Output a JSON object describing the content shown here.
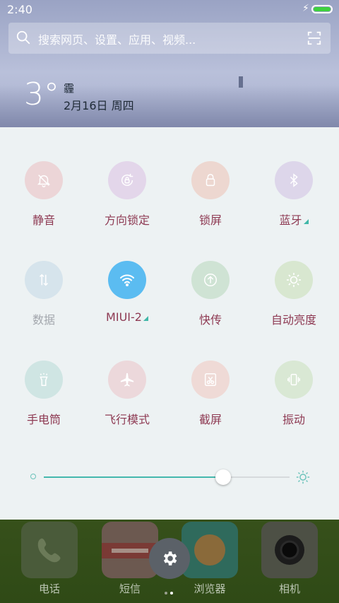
{
  "status": {
    "time": "2:40"
  },
  "search": {
    "placeholder": "搜索网页、设置、应用、视频..."
  },
  "weather": {
    "temperature": "3°",
    "condition": "霾",
    "date": "2月16日 周四"
  },
  "tiles": [
    {
      "label": "静音",
      "icon": "silent-bell-icon"
    },
    {
      "label": "方向锁定",
      "icon": "rotation-lock-icon"
    },
    {
      "label": "锁屏",
      "icon": "lock-icon"
    },
    {
      "label": "蓝牙",
      "icon": "bluetooth-icon"
    },
    {
      "label": "数据",
      "icon": "mobile-data-icon"
    },
    {
      "label": "MIUI-2",
      "icon": "wifi-icon"
    },
    {
      "label": "快传",
      "icon": "upload-icon"
    },
    {
      "label": "自动亮度",
      "icon": "auto-brightness-icon"
    },
    {
      "label": "手电筒",
      "icon": "flashlight-icon"
    },
    {
      "label": "飞行模式",
      "icon": "airplane-icon"
    },
    {
      "label": "截屏",
      "icon": "screenshot-icon"
    },
    {
      "label": "振动",
      "icon": "vibrate-icon"
    }
  ],
  "brightness": {
    "level": 0.73
  },
  "dock": [
    {
      "label": "电话",
      "icon": "phone-icon"
    },
    {
      "label": "短信",
      "icon": "messages-icon"
    },
    {
      "label": "浏览器",
      "icon": "browser-icon"
    },
    {
      "label": "相机",
      "icon": "camera-icon"
    }
  ],
  "colors": {
    "accent": "#45b8ad",
    "label": "#8e3a53",
    "wifi_on": "#5bbcf1"
  }
}
